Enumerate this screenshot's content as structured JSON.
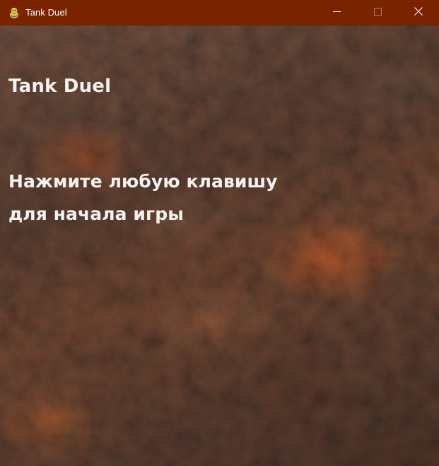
{
  "window": {
    "title": "Tank Duel",
    "icon": "pygame-snake-icon",
    "controls": {
      "minimize": "minimize-icon",
      "maximize": "maximize-icon",
      "close": "close-icon"
    },
    "colors": {
      "titlebar": "#7a2300",
      "text": "#ffffff"
    }
  },
  "screen": {
    "heading": "Tank Duel",
    "prompt_lines": [
      "Нажмите любую клавишу",
      "для начала игры"
    ],
    "colors": {
      "text": "#f4f2ee",
      "background": "#3e2f28"
    }
  }
}
